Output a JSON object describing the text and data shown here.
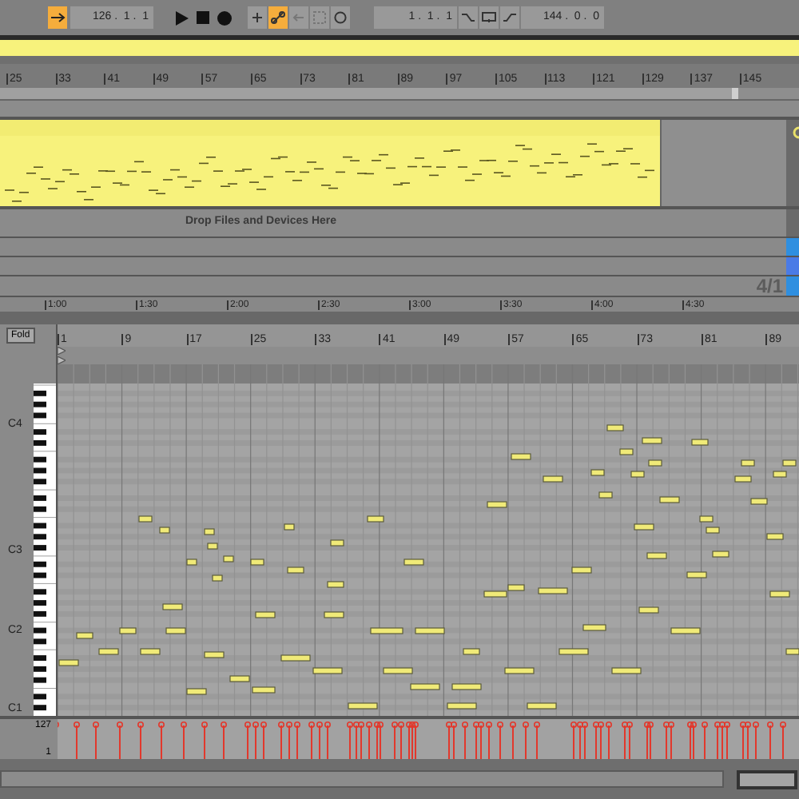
{
  "toolbar": {
    "position": "126 .  1 .  1",
    "loop_start": "1 .  1 .  1",
    "loop_length": "144 .  0 .  0",
    "toggles": [
      {
        "kind": "follow",
        "on": true
      },
      {
        "kind": "add",
        "on": false
      },
      {
        "kind": "automation",
        "on": true
      },
      {
        "kind": "back",
        "on": false
      },
      {
        "kind": "capture",
        "on": false
      },
      {
        "kind": "record",
        "on": false
      },
      {
        "kind": "punch_in",
        "on": false
      },
      {
        "kind": "loop",
        "on": false
      },
      {
        "kind": "punch_out",
        "on": false
      }
    ]
  },
  "bar_ruler": [
    "25",
    "33",
    "41",
    "49",
    "57",
    "65",
    "73",
    "81",
    "89",
    "97",
    "105",
    "113",
    "121",
    "129",
    "137",
    "145"
  ],
  "drop_hint": "Drop Files and Devices Here",
  "grid_setting": "4/1",
  "time_ruler": [
    "1:00",
    "1:30",
    "2:00",
    "2:30",
    "3:00",
    "3:30",
    "4:00",
    "4:30"
  ],
  "piano_roll": {
    "fold_button": "Fold",
    "ruler": [
      "1",
      "9",
      "17",
      "25",
      "33",
      "41",
      "49",
      "57",
      "65",
      "73",
      "81",
      "89"
    ],
    "key_labels": [
      "C4",
      "C3",
      "C2",
      "C1"
    ],
    "velocity_max": "127",
    "velocity_min": "1"
  }
}
